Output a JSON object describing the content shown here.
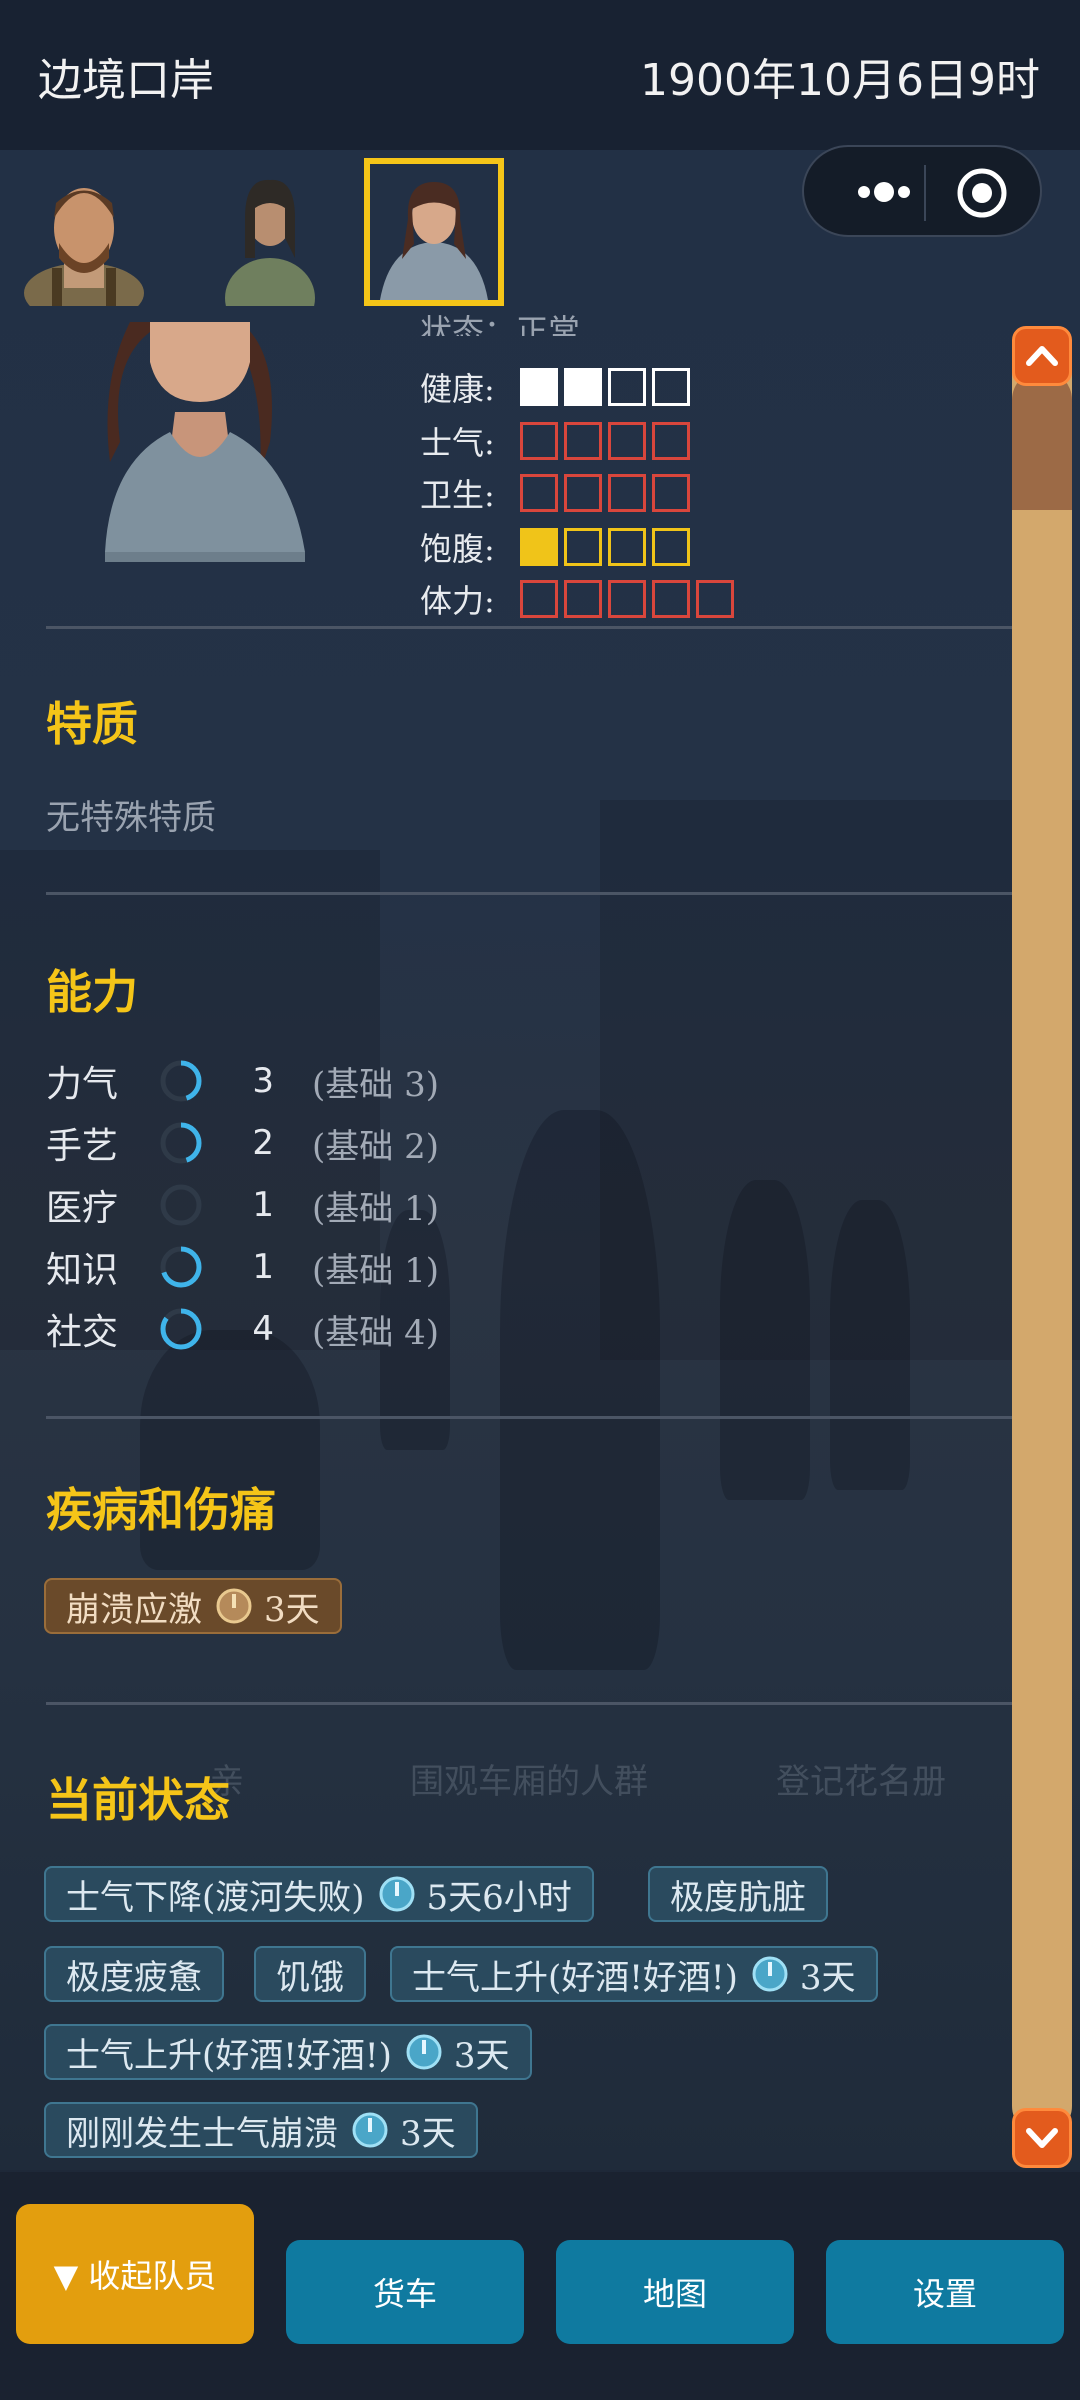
{
  "header": {
    "location": "边境口岸",
    "datetime": "1900年10月6日9时"
  },
  "character": {
    "status_label_partial": "状态：正常",
    "stats": [
      {
        "label": "健康:",
        "color": "white",
        "total": 4,
        "filled": 2
      },
      {
        "label": "士气:",
        "color": "red",
        "total": 4,
        "filled": 0
      },
      {
        "label": "卫生:",
        "color": "red",
        "total": 4,
        "filled": 0
      },
      {
        "label": "饱腹:",
        "color": "yellow",
        "total": 4,
        "filled": 1
      },
      {
        "label": "体力:",
        "color": "red",
        "total": 5,
        "filled": 0
      }
    ]
  },
  "traits": {
    "title": "特质",
    "text": "无特殊特质"
  },
  "abilities": {
    "title": "能力",
    "items": [
      {
        "name": "力气",
        "value": "3",
        "base": "(基础 3)",
        "progress": 0.45
      },
      {
        "name": "手艺",
        "value": "2",
        "base": "(基础 2)",
        "progress": 0.45
      },
      {
        "name": "医疗",
        "value": "1",
        "base": "(基础 1)",
        "progress": 0.0
      },
      {
        "name": "知识",
        "value": "1",
        "base": "(基础 1)",
        "progress": 0.7
      },
      {
        "name": "社交",
        "value": "4",
        "base": "(基础 4)",
        "progress": 0.85
      }
    ]
  },
  "illness": {
    "title": "疾病和伤痛",
    "tags": [
      {
        "text": "崩溃应激",
        "duration": "3天"
      }
    ]
  },
  "current_status": {
    "title": "当前状态",
    "tags": [
      {
        "text": "士气下降(渡河失败)",
        "duration": "5天6小时"
      },
      {
        "text": "极度肮脏",
        "duration": ""
      },
      {
        "text": "极度疲惫",
        "duration": ""
      },
      {
        "text": "饥饿",
        "duration": ""
      },
      {
        "text": "士气上升(好酒!好酒!)",
        "duration": "3天"
      },
      {
        "text": "士气上升(好酒!好酒!)",
        "duration": "3天"
      },
      {
        "text": "刚刚发生士气崩溃",
        "duration": "3天"
      }
    ]
  },
  "background_text": {
    "item1": "亲",
    "item2": "围观车厢的人群",
    "item3": "登记花名册"
  },
  "bottom_nav": {
    "collapse": "▼ 收起队员",
    "truck": "货车",
    "map": "地图",
    "settings": "设置"
  },
  "colors": {
    "accent_gold": "#f5c518",
    "button_blue": "#0f7aa0",
    "button_gold": "#e39e0e",
    "scroll_orange": "#e35b1d"
  }
}
